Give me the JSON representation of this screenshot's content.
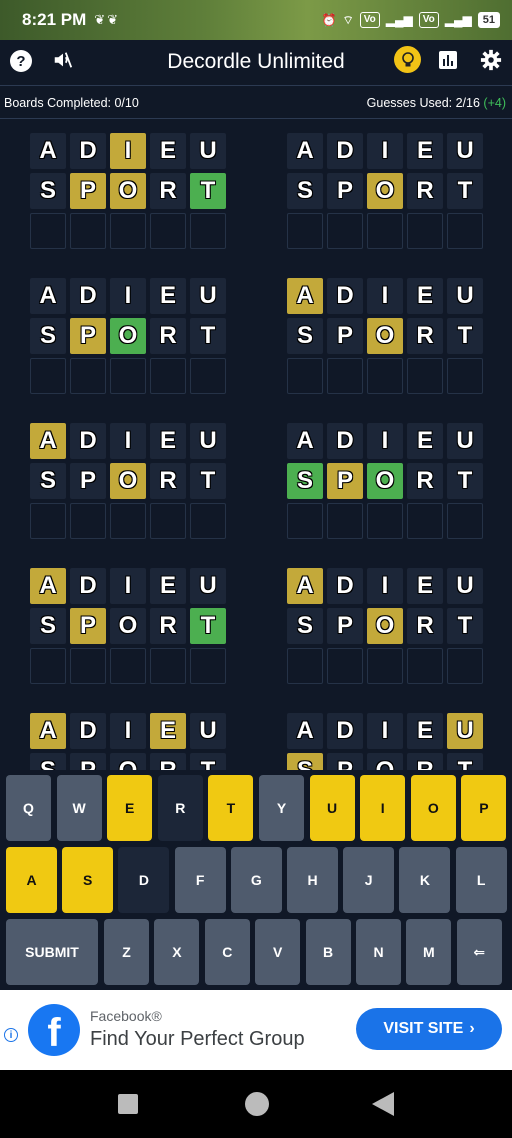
{
  "status": {
    "time": "8:21 PM",
    "battery": "51"
  },
  "header": {
    "title": "Decordle Unlimited"
  },
  "info": {
    "boards_completed": "Boards Completed: 0/10",
    "guesses_used": "Guesses Used: 2/16",
    "bonus": "(+4)"
  },
  "colors": {
    "yellow_tile": "#c3a93a",
    "green_tile": "#4caf50",
    "key_present": "#f0c912",
    "bg": "#101827"
  },
  "boards": [
    {
      "rows": [
        [
          [
            "A",
            "n"
          ],
          [
            "D",
            "n"
          ],
          [
            "I",
            "y"
          ],
          [
            "E",
            "n"
          ],
          [
            "U",
            "n"
          ]
        ],
        [
          [
            "S",
            "n"
          ],
          [
            "P",
            "y"
          ],
          [
            "O",
            "y"
          ],
          [
            "R",
            "n"
          ],
          [
            "T",
            "g"
          ]
        ],
        [
          [
            "",
            "e"
          ],
          [
            "",
            "e"
          ],
          [
            "",
            "e"
          ],
          [
            "",
            "e"
          ],
          [
            "",
            "e"
          ]
        ]
      ]
    },
    {
      "rows": [
        [
          [
            "A",
            "n"
          ],
          [
            "D",
            "n"
          ],
          [
            "I",
            "n"
          ],
          [
            "E",
            "n"
          ],
          [
            "U",
            "n"
          ]
        ],
        [
          [
            "S",
            "n"
          ],
          [
            "P",
            "n"
          ],
          [
            "O",
            "y"
          ],
          [
            "R",
            "n"
          ],
          [
            "T",
            "n"
          ]
        ],
        [
          [
            "",
            "e"
          ],
          [
            "",
            "e"
          ],
          [
            "",
            "e"
          ],
          [
            "",
            "e"
          ],
          [
            "",
            "e"
          ]
        ]
      ]
    },
    {
      "rows": [
        [
          [
            "A",
            "n"
          ],
          [
            "D",
            "n"
          ],
          [
            "I",
            "n"
          ],
          [
            "E",
            "n"
          ],
          [
            "U",
            "n"
          ]
        ],
        [
          [
            "S",
            "n"
          ],
          [
            "P",
            "y"
          ],
          [
            "O",
            "g"
          ],
          [
            "R",
            "n"
          ],
          [
            "T",
            "n"
          ]
        ],
        [
          [
            "",
            "e"
          ],
          [
            "",
            "e"
          ],
          [
            "",
            "e"
          ],
          [
            "",
            "e"
          ],
          [
            "",
            "e"
          ]
        ]
      ]
    },
    {
      "rows": [
        [
          [
            "A",
            "y"
          ],
          [
            "D",
            "n"
          ],
          [
            "I",
            "n"
          ],
          [
            "E",
            "n"
          ],
          [
            "U",
            "n"
          ]
        ],
        [
          [
            "S",
            "n"
          ],
          [
            "P",
            "n"
          ],
          [
            "O",
            "y"
          ],
          [
            "R",
            "n"
          ],
          [
            "T",
            "n"
          ]
        ],
        [
          [
            "",
            "e"
          ],
          [
            "",
            "e"
          ],
          [
            "",
            "e"
          ],
          [
            "",
            "e"
          ],
          [
            "",
            "e"
          ]
        ]
      ]
    },
    {
      "rows": [
        [
          [
            "A",
            "y"
          ],
          [
            "D",
            "n"
          ],
          [
            "I",
            "n"
          ],
          [
            "E",
            "n"
          ],
          [
            "U",
            "n"
          ]
        ],
        [
          [
            "S",
            "n"
          ],
          [
            "P",
            "n"
          ],
          [
            "O",
            "y"
          ],
          [
            "R",
            "n"
          ],
          [
            "T",
            "n"
          ]
        ],
        [
          [
            "",
            "e"
          ],
          [
            "",
            "e"
          ],
          [
            "",
            "e"
          ],
          [
            "",
            "e"
          ],
          [
            "",
            "e"
          ]
        ]
      ]
    },
    {
      "rows": [
        [
          [
            "A",
            "n"
          ],
          [
            "D",
            "n"
          ],
          [
            "I",
            "n"
          ],
          [
            "E",
            "n"
          ],
          [
            "U",
            "n"
          ]
        ],
        [
          [
            "S",
            "g"
          ],
          [
            "P",
            "y"
          ],
          [
            "O",
            "g"
          ],
          [
            "R",
            "n"
          ],
          [
            "T",
            "n"
          ]
        ],
        [
          [
            "",
            "e"
          ],
          [
            "",
            "e"
          ],
          [
            "",
            "e"
          ],
          [
            "",
            "e"
          ],
          [
            "",
            "e"
          ]
        ]
      ]
    },
    {
      "rows": [
        [
          [
            "A",
            "y"
          ],
          [
            "D",
            "n"
          ],
          [
            "I",
            "n"
          ],
          [
            "E",
            "n"
          ],
          [
            "U",
            "n"
          ]
        ],
        [
          [
            "S",
            "n"
          ],
          [
            "P",
            "y"
          ],
          [
            "O",
            "n"
          ],
          [
            "R",
            "n"
          ],
          [
            "T",
            "g"
          ]
        ],
        [
          [
            "",
            "e"
          ],
          [
            "",
            "e"
          ],
          [
            "",
            "e"
          ],
          [
            "",
            "e"
          ],
          [
            "",
            "e"
          ]
        ]
      ]
    },
    {
      "rows": [
        [
          [
            "A",
            "y"
          ],
          [
            "D",
            "n"
          ],
          [
            "I",
            "n"
          ],
          [
            "E",
            "n"
          ],
          [
            "U",
            "n"
          ]
        ],
        [
          [
            "S",
            "n"
          ],
          [
            "P",
            "n"
          ],
          [
            "O",
            "y"
          ],
          [
            "R",
            "n"
          ],
          [
            "T",
            "n"
          ]
        ],
        [
          [
            "",
            "e"
          ],
          [
            "",
            "e"
          ],
          [
            "",
            "e"
          ],
          [
            "",
            "e"
          ],
          [
            "",
            "e"
          ]
        ]
      ]
    },
    {
      "rows": [
        [
          [
            "A",
            "y"
          ],
          [
            "D",
            "n"
          ],
          [
            "I",
            "n"
          ],
          [
            "E",
            "y"
          ],
          [
            "U",
            "n"
          ]
        ],
        [
          [
            "S",
            "n"
          ],
          [
            "P",
            "n"
          ],
          [
            "O",
            "n"
          ],
          [
            "R",
            "n"
          ],
          [
            "T",
            "n"
          ]
        ]
      ]
    },
    {
      "rows": [
        [
          [
            "A",
            "n"
          ],
          [
            "D",
            "n"
          ],
          [
            "I",
            "n"
          ],
          [
            "E",
            "n"
          ],
          [
            "U",
            "y"
          ]
        ],
        [
          [
            "S",
            "y"
          ],
          [
            "P",
            "n"
          ],
          [
            "O",
            "n"
          ],
          [
            "R",
            "n"
          ],
          [
            "T",
            "n"
          ]
        ]
      ]
    }
  ],
  "keyboard": {
    "row1": [
      [
        "Q",
        "u"
      ],
      [
        "W",
        "u"
      ],
      [
        "E",
        "p"
      ],
      [
        "R",
        "x"
      ],
      [
        "T",
        "p"
      ],
      [
        "Y",
        "u"
      ],
      [
        "U",
        "p"
      ],
      [
        "I",
        "p"
      ],
      [
        "O",
        "p"
      ],
      [
        "P",
        "p"
      ]
    ],
    "row2": [
      [
        "A",
        "p"
      ],
      [
        "S",
        "p"
      ],
      [
        "D",
        "x"
      ],
      [
        "F",
        "u"
      ],
      [
        "G",
        "u"
      ],
      [
        "H",
        "u"
      ],
      [
        "J",
        "u"
      ],
      [
        "K",
        "u"
      ],
      [
        "L",
        "u"
      ]
    ],
    "row3": [
      [
        "SUBMIT",
        "u"
      ],
      [
        "Z",
        "u"
      ],
      [
        "X",
        "u"
      ],
      [
        "C",
        "u"
      ],
      [
        "V",
        "u"
      ],
      [
        "B",
        "u"
      ],
      [
        "N",
        "u"
      ],
      [
        "M",
        "u"
      ],
      [
        "⇐",
        "u"
      ]
    ]
  },
  "ad": {
    "advertiser": "Facebook®",
    "headline": "Find Your Perfect Group",
    "cta": "VISIT SITE"
  }
}
